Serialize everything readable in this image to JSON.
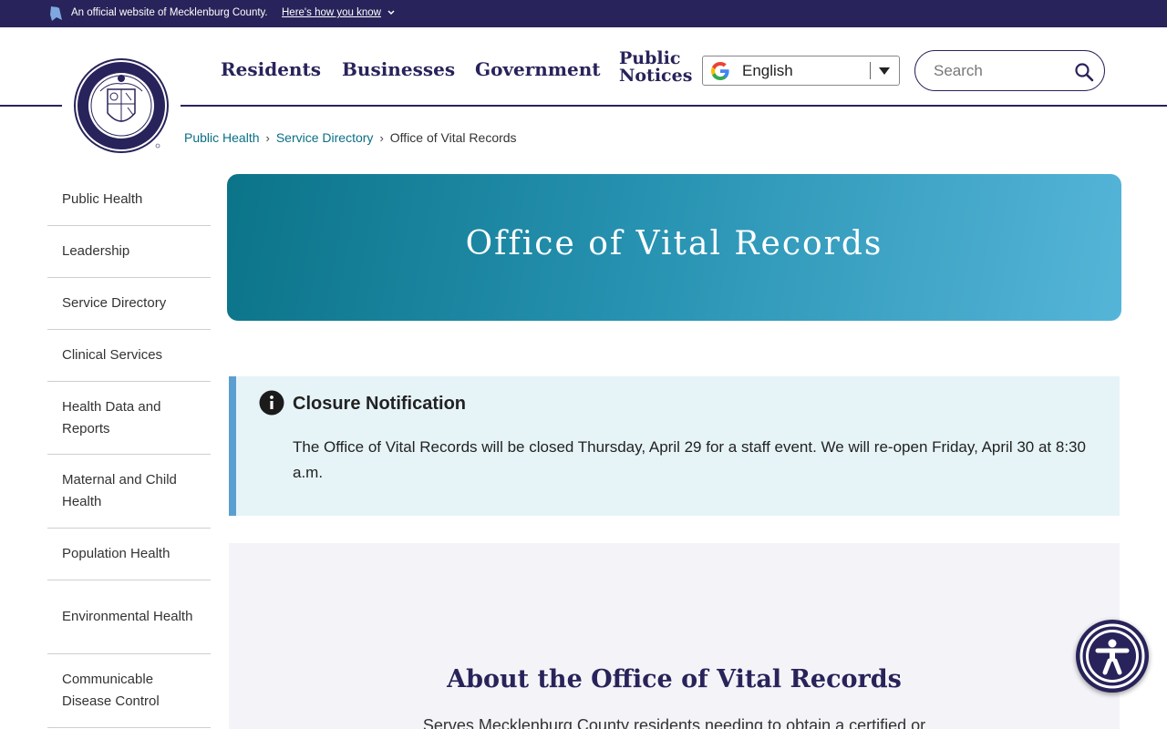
{
  "official_bar": {
    "text": "An official website of Mecklenburg County.",
    "link": "Here's how you know"
  },
  "nav": {
    "residents": "Residents",
    "businesses": "Businesses",
    "government": "Government",
    "public_notices": "Public Notices"
  },
  "language": {
    "selected": "English"
  },
  "search": {
    "placeholder": "Search"
  },
  "breadcrumb": {
    "items": [
      "Public Health",
      "Service Directory"
    ],
    "current": "Office of Vital Records"
  },
  "sidebar": {
    "items": [
      {
        "label": "Public Health"
      },
      {
        "label": "Leadership"
      },
      {
        "label": "Service Directory"
      },
      {
        "label": "Clinical Services"
      },
      {
        "label": "Health Data and Reports"
      },
      {
        "label": "Maternal and Child Health"
      },
      {
        "label": "Population Health"
      },
      {
        "label": "Environmental Health"
      },
      {
        "label": "Communicable Disease Control"
      }
    ]
  },
  "hero": {
    "title": "Office of Vital Records"
  },
  "alert": {
    "title": "Closure Notification",
    "body": "The Office of Vital Records will be closed Thursday, April 29 for a staff event. We will re-open Friday, April 30 at 8:30 a.m."
  },
  "about": {
    "title": "About the Office of Vital Records",
    "text": "Serves Mecklenburg County residents needing to obtain a certified or"
  },
  "colors": {
    "navy": "#28235a",
    "teal_link": "#0a6f86",
    "alert_bg": "#e6f4f8",
    "alert_border": "#5b9fd1"
  }
}
